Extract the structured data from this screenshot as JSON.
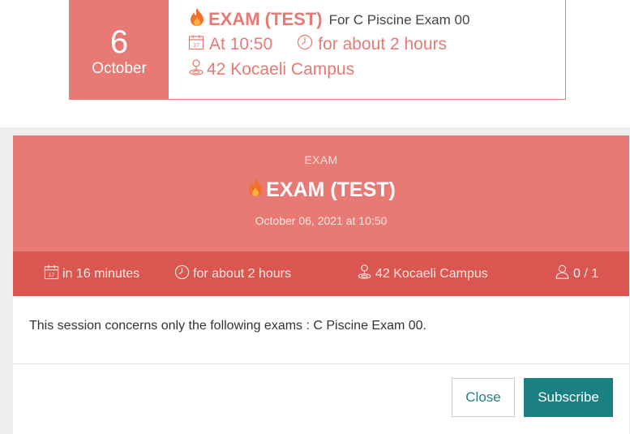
{
  "event_card": {
    "day": "6",
    "month": "October",
    "title": "EXAM (TEST)",
    "subtitle": "For C Piscine Exam 00",
    "time": "At 10:50",
    "duration": "for about 2 hours",
    "location": "42 Kocaeli Campus"
  },
  "modal": {
    "kind": "EXAM",
    "title": "EXAM (TEST)",
    "datetime": "October 06, 2021 at 10:50",
    "bar": {
      "starts_in": "in 16 minutes",
      "duration": "for about 2 hours",
      "location": "42 Kocaeli Campus",
      "seats": "0 / 1"
    },
    "body_text": "This session concerns only the following exams : C Piscine Exam 00.",
    "close_label": "Close",
    "subscribe_label": "Subscribe"
  },
  "colors": {
    "accent": "#e77a74",
    "accent_dark": "#d95750",
    "button_teal": "#1b8082"
  },
  "icons": [
    "fire-icon",
    "calendar-icon",
    "clock-icon",
    "location-pin-icon",
    "user-icon"
  ]
}
